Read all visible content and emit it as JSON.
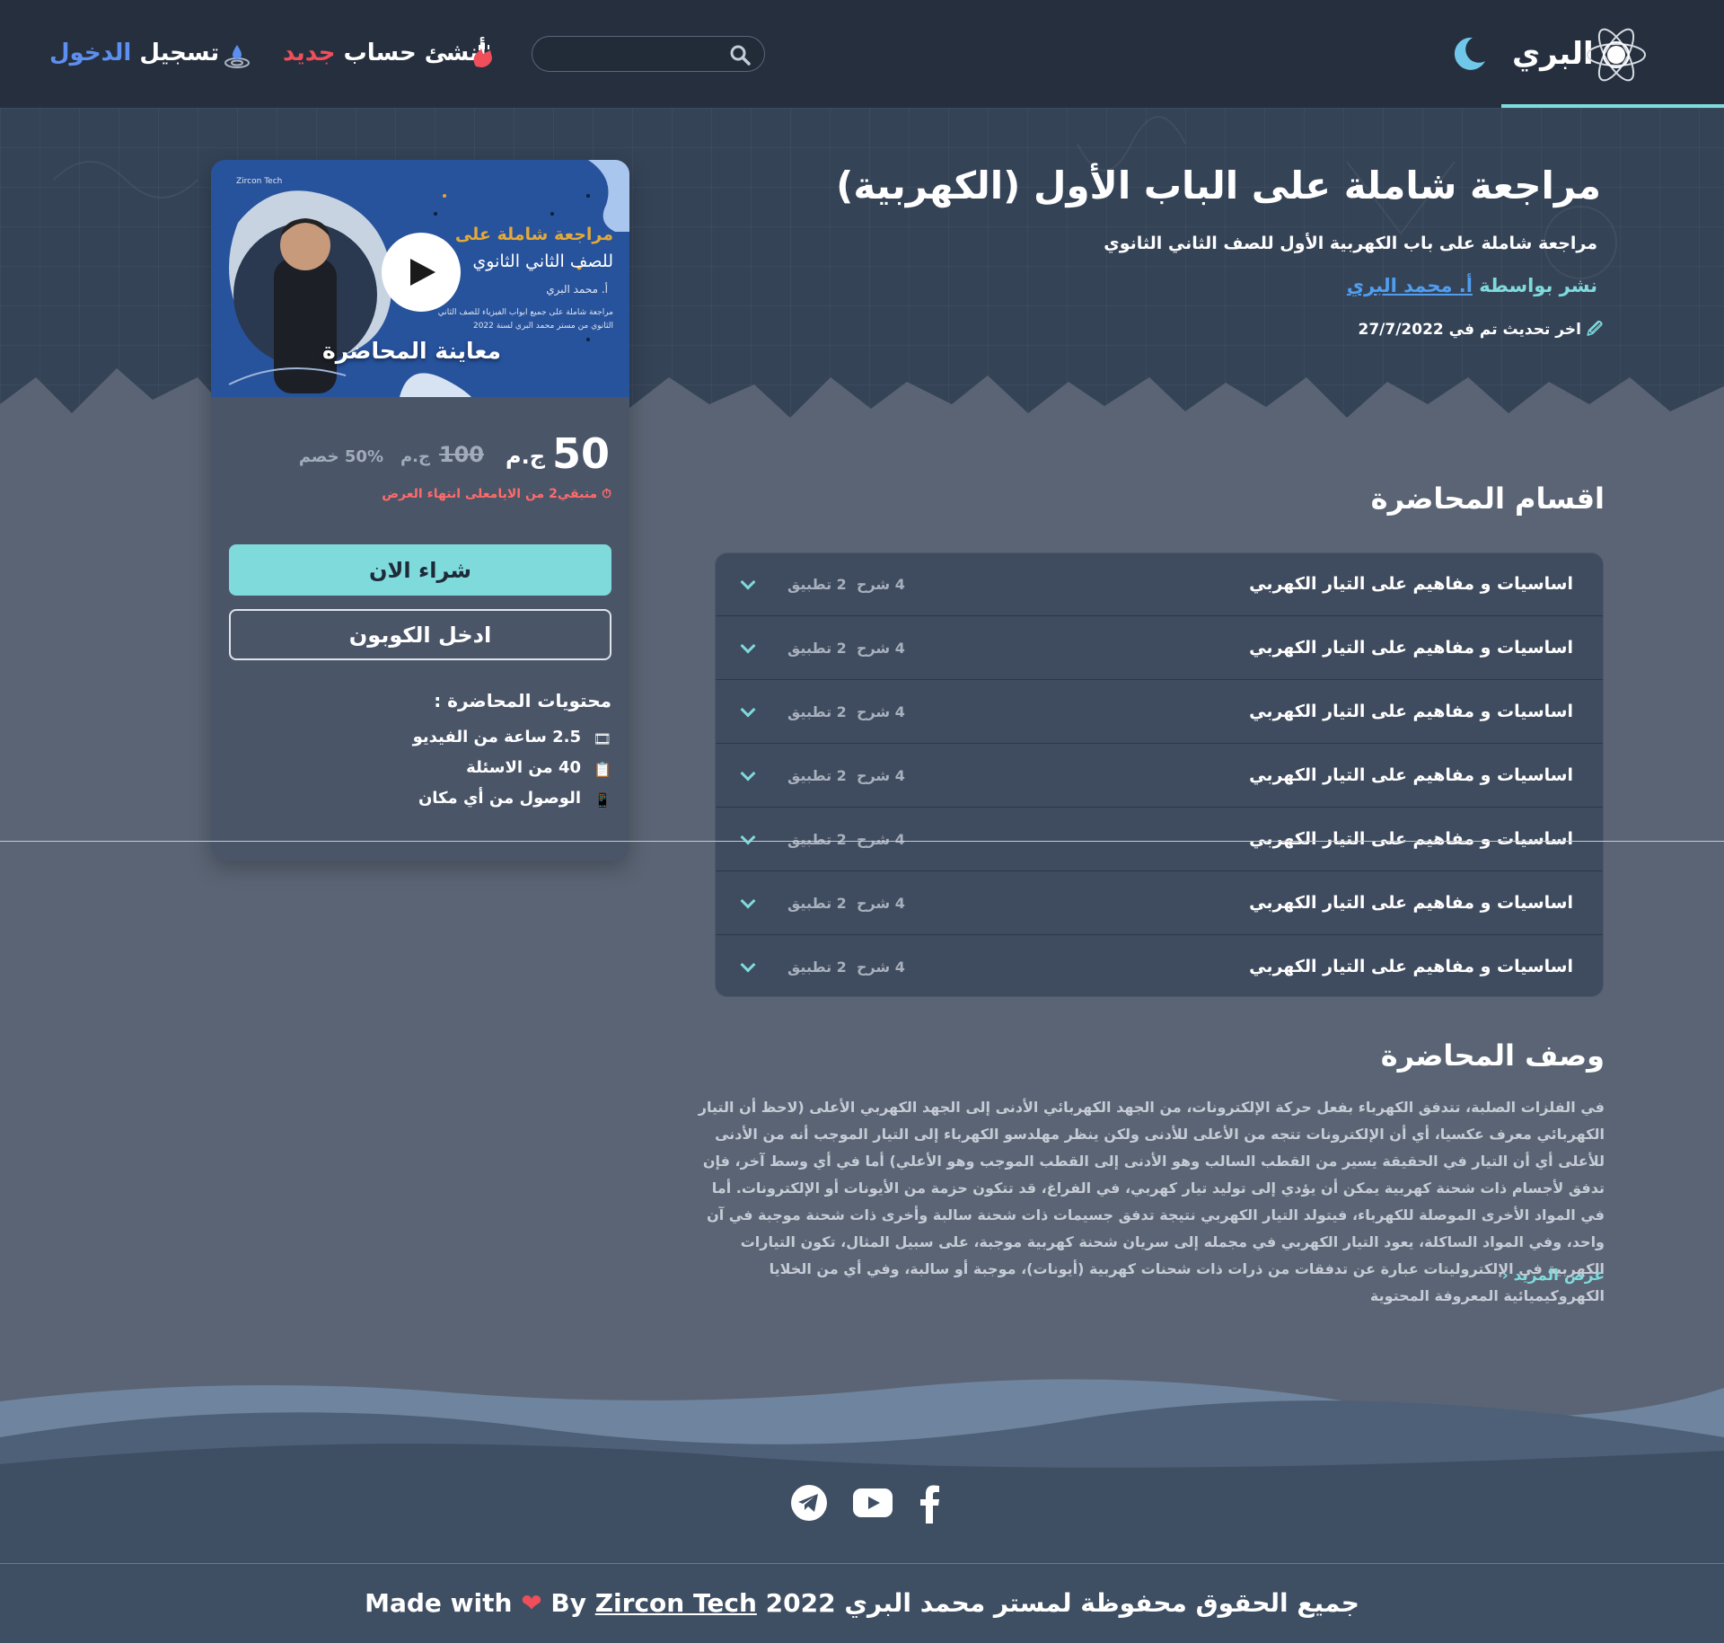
{
  "header": {
    "logo_text": "البري",
    "search_placeholder": "",
    "signup_prefix": "أنشئ حساب",
    "signup_highlight": "جديد",
    "login_prefix": "تسجيل",
    "login_highlight": "الدخول",
    "colors": {
      "accent": "#7fdadc",
      "signup_highlight": "#ef4f5a",
      "login_highlight": "#5d8ff0"
    }
  },
  "course": {
    "title": "مراجعة شاملة على الباب الأول (الكهربية)",
    "subtitle": "مراجعة شاملة على باب الكهربية الأول للصف الثاني الثانوي",
    "published_by_label": "نشر بواسطة",
    "author_prefix": "أ.",
    "author_name": "محمد البري",
    "last_update_label": "اخر تحديث تم  في",
    "last_update_date": "27/7/2022"
  },
  "card": {
    "thumb_title_line1": "مراجعة شاملة على المنهج",
    "thumb_title_line2": "للصف الثاني الثانوي",
    "thumb_author": "أ. محمد البري",
    "thumb_desc_line1": "مراجعة شاملة على جميع ابواب الفيزياء للصف الثاني",
    "thumb_desc_line2": "الثانوي من مستر محمد البري لسنة 2022",
    "thumb_brand": "Zircon Tech",
    "preview_label": "معاينة المحاضرة",
    "price": "50",
    "currency": "ج.م",
    "old_price": "100",
    "old_currency": "ج.م",
    "discount": "50% خصم",
    "timer_text": "متبقي2 من الايامعلى انتهاء العرض",
    "buy_label": "شراء الان",
    "coupon_label": "ادخل الكوبون",
    "includes_title": "محتويات المحاضرة :",
    "includes": [
      {
        "icon": "video-icon",
        "text": "2.5 ساعة من الفيديو"
      },
      {
        "icon": "clipboard-icon",
        "text": "40 من الاسئلة"
      },
      {
        "icon": "phone-icon",
        "text": "الوصول من أي مكان"
      }
    ]
  },
  "sections": {
    "heading": "اقسام المحاضرة",
    "items": [
      {
        "title": "اساسيات و مفاهيم على التيار الكهربي",
        "explain": "4 شرح",
        "practice": "2 تطبيق"
      },
      {
        "title": "اساسيات و مفاهيم على التيار الكهربي",
        "explain": "4 شرح",
        "practice": "2 تطبيق"
      },
      {
        "title": "اساسيات و مفاهيم على التيار الكهربي",
        "explain": "4 شرح",
        "practice": "2 تطبيق"
      },
      {
        "title": "اساسيات و مفاهيم على التيار الكهربي",
        "explain": "4 شرح",
        "practice": "2 تطبيق"
      },
      {
        "title": "اساسيات و مفاهيم على التيار الكهربي",
        "explain": "4 شرح",
        "practice": "2 تطبيق"
      },
      {
        "title": "اساسيات و مفاهيم على التيار الكهربي",
        "explain": "4 شرح",
        "practice": "2 تطبيق"
      },
      {
        "title": "اساسيات و مفاهيم على التيار الكهربي",
        "explain": "4 شرح",
        "practice": "2 تطبيق"
      }
    ]
  },
  "description": {
    "heading": "وصف المحاضرة",
    "lines": [
      "في الفلزات الصلبة، تتدفق الكهرباء بفعل حركة الإلكترونات، من الجهد الكهربائي الأدنى إلى الجهد الكهربي الأعلى (لاحظ أن التيار",
      "الكهربائي معرف عكسيا، أي أن الإلكترونات تتجه من الأعلى للأدنى ولكن ينظر مهلدسو الكهرباء إلى التيار الموجب أنه من الأدنى",
      "للأعلى أي أن التيار في الحقيقة يسير من القطب السالب وهو الأدنى إلى القطب الموجب وهو الأعلي) أما في أي وسط آخر، فإن أي",
      "تدفق لأجسام ذات شحنة كهربية يمكن أن يؤدي إلى توليد تيار كهربي، في الفراغ، قد تتكون حزمة من الأيونات أو الإلكترونات. أما",
      "في المواد الأخرى الموصلة للكهرباء، فيتولد التيار الكهربي نتيجة تدفق جسيمات ذات شحنة سالبة وأخرى ذات شحنة موجبة في آن",
      "واحد، وفي المواد الساكلة، يعود التيار الكهربي في مجمله إلى  سريان شحنة كهربية موجبة، على سبيل المثال، تكون التيارات",
      "الكهربية في الإلكتروليتات عبارة عن تدفقات من ذرات ذات شحنات كهربية (أيونات)، موجبة أو سالبة، وفي أي من الخلايا",
      "الكهروكيميائية المعروفة المحتوية"
    ],
    "more_label": "عرض المزيد"
  },
  "social": [
    {
      "name": "telegram-icon"
    },
    {
      "name": "youtube-icon"
    },
    {
      "name": "facebook-icon"
    }
  ],
  "footer": {
    "rights": "جميع الحقوق محفوظة لمستر محمد البري 2022",
    "made_with": "Made with",
    "by": "By",
    "company": "Zircon Tech"
  }
}
